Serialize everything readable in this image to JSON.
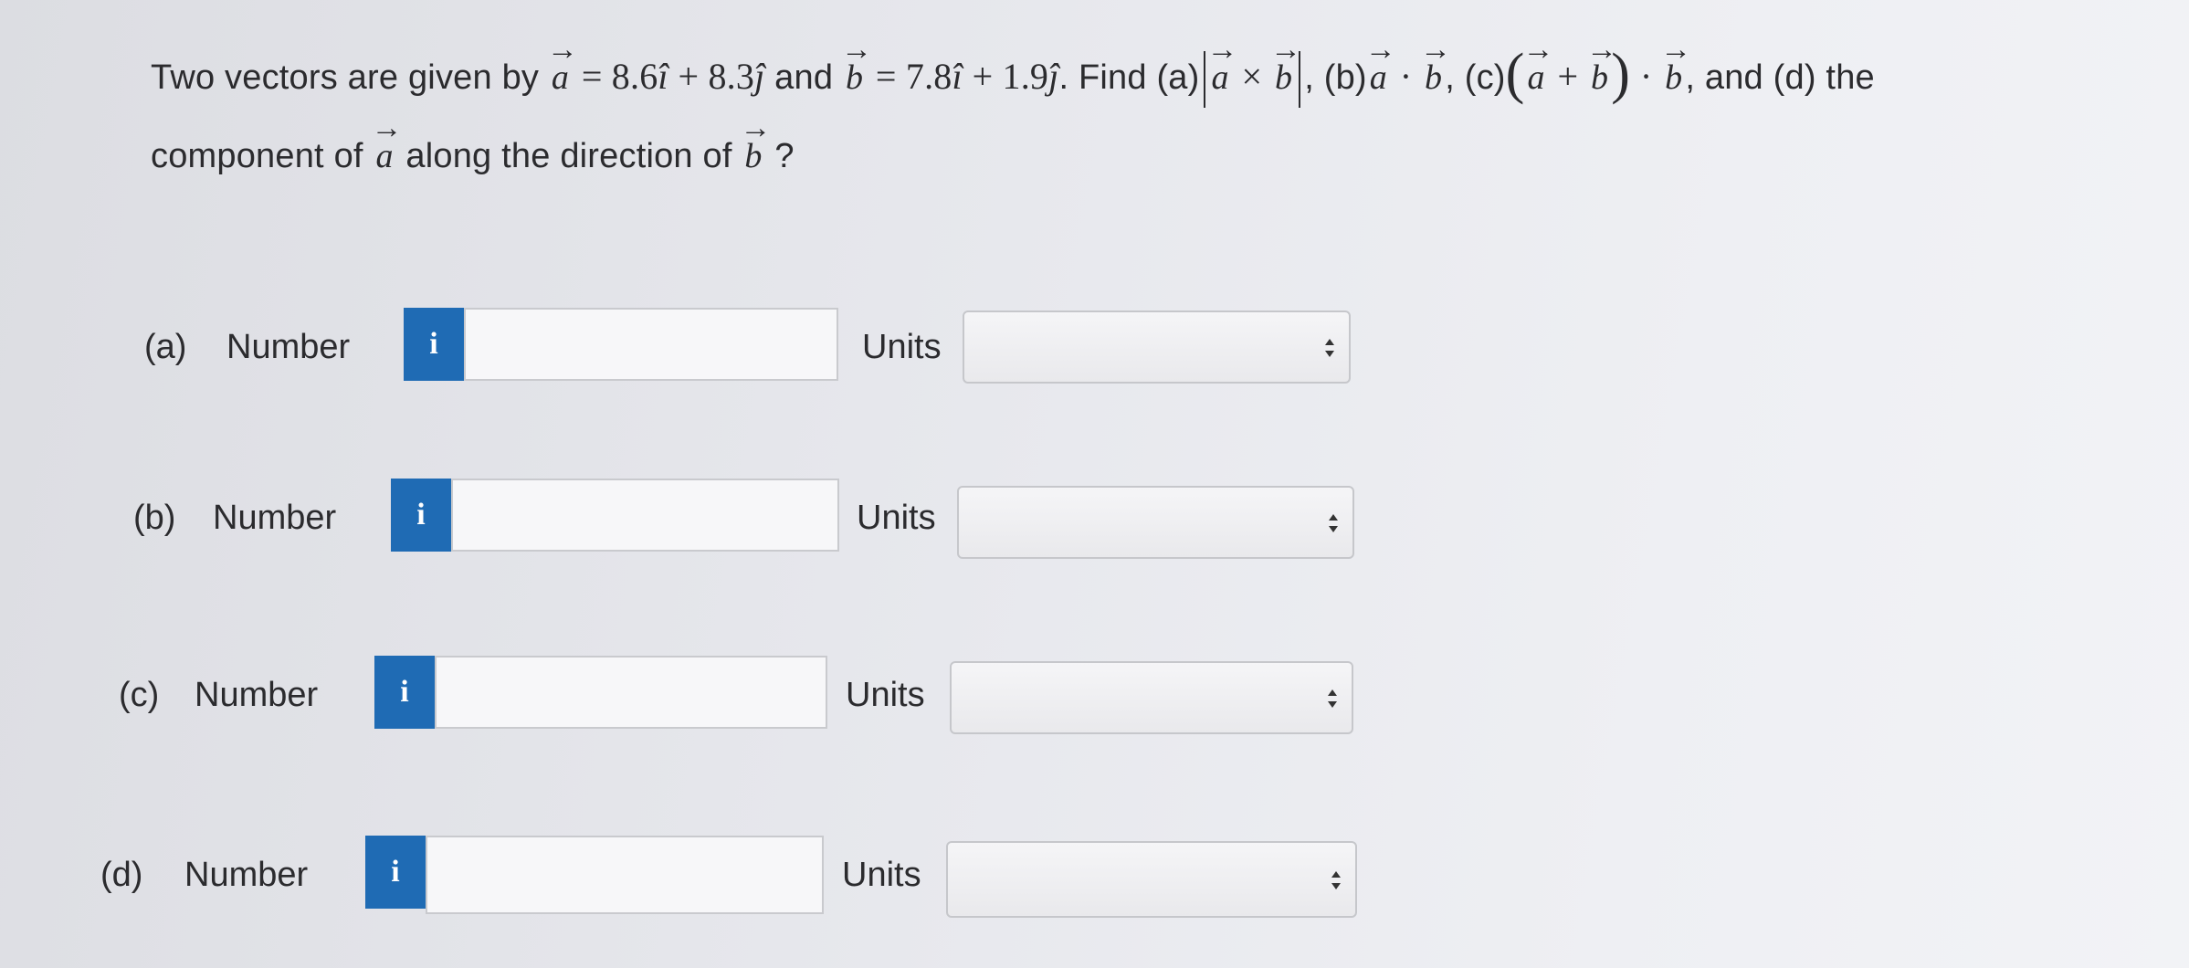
{
  "question": {
    "t1": "Two vectors are given by",
    "a_sym": "a",
    "eq_a": "= 8.6",
    "i_hat": "î",
    "plus1": "+ 8.3",
    "j_hat": "ĵ",
    "and1": "and",
    "b_sym": "b",
    "eq_b": "= 7.8",
    "plus2": "+ 1.9",
    "find": ". Find (a)",
    "times": "×",
    "part_b": ", (b)",
    "dot": "·",
    "part_c": ", (c)",
    "open_paren": "(",
    "plus": "+",
    "close_paren": ")",
    "part_d": ", and (d) the",
    "line2_start": "component of",
    "along": "along the direction of",
    "qmark": "?"
  },
  "rows": [
    {
      "part": "(a)",
      "label": "Number",
      "info": "i",
      "value": "",
      "units_label": "Units",
      "units_value": ""
    },
    {
      "part": "(b)",
      "label": "Number",
      "info": "i",
      "value": "",
      "units_label": "Units",
      "units_value": ""
    },
    {
      "part": "(c)",
      "label": "Number",
      "info": "i",
      "value": "",
      "units_label": "Units",
      "units_value": ""
    },
    {
      "part": "(d)",
      "label": "Number",
      "info": "i",
      "value": "",
      "units_label": "Units",
      "units_value": ""
    }
  ],
  "colors": {
    "info_button": "#1f6bb4",
    "text": "#2b2b2e"
  }
}
